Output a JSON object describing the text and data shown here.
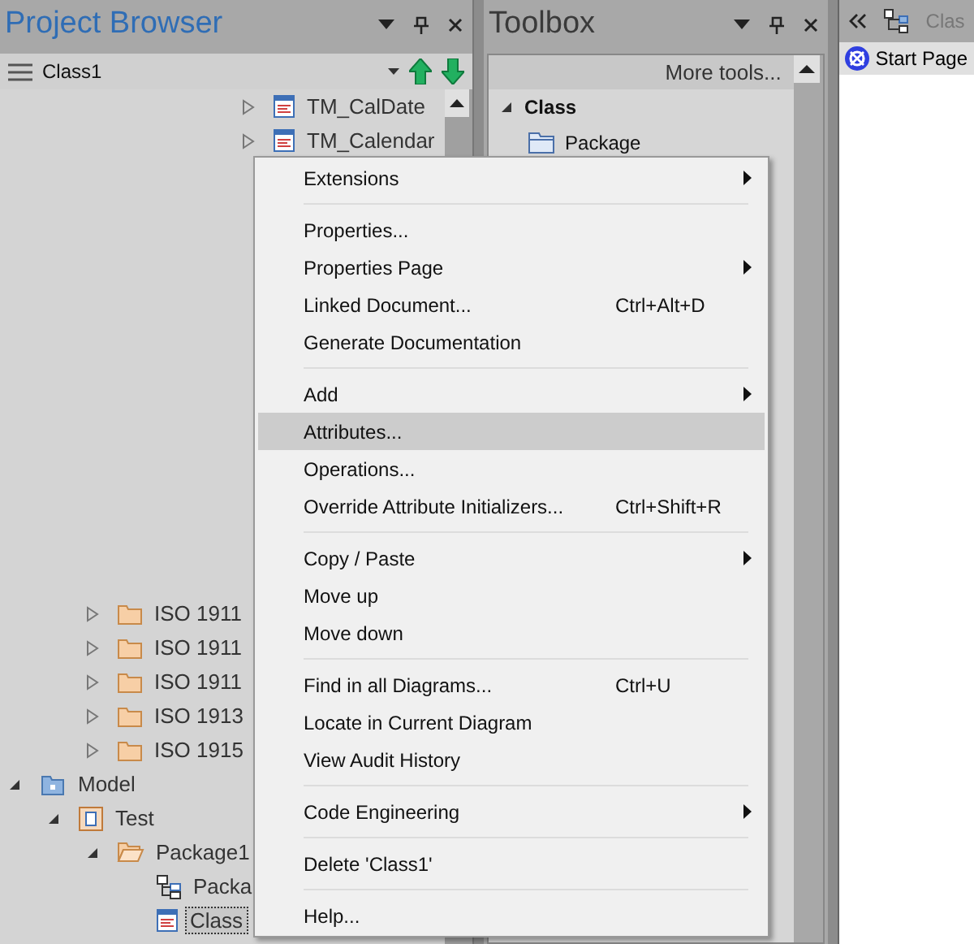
{
  "project_browser": {
    "title": "Project Browser",
    "toolbar": {
      "current": "Class1"
    },
    "upper_items": [
      {
        "label": "TM_CalDate",
        "kind": "class",
        "expanded": false,
        "selected": false
      },
      {
        "label": "TM_Calendar",
        "kind": "class",
        "expanded": false,
        "selected": false
      }
    ],
    "middle_items": [
      {
        "label": "ISO 1911",
        "kind": "folder",
        "expanded": false,
        "selected": false
      },
      {
        "label": "ISO 1911",
        "kind": "folder",
        "expanded": false,
        "selected": false
      },
      {
        "label": "ISO 1911",
        "kind": "folder",
        "expanded": false,
        "selected": false
      },
      {
        "label": "ISO 1913",
        "kind": "folder",
        "expanded": false,
        "selected": false
      },
      {
        "label": "ISO 1915",
        "kind": "folder",
        "expanded": false,
        "selected": false
      }
    ],
    "roots": [
      {
        "label": "Model",
        "kind": "model",
        "expanded": true,
        "selected": false,
        "children": [
          {
            "label": "Test",
            "kind": "view",
            "expanded": true,
            "selected": false,
            "children": [
              {
                "label": "Package1",
                "kind": "package",
                "expanded": true,
                "selected": false,
                "children": [
                  {
                    "label": "Packa",
                    "kind": "diagram",
                    "selected": false
                  },
                  {
                    "label": "Class",
                    "kind": "class",
                    "selected": true
                  }
                ]
              }
            ]
          }
        ]
      }
    ]
  },
  "toolbox": {
    "title": "Toolbox",
    "more_tools": "More tools...",
    "group": {
      "label": "Class",
      "expanded": true
    },
    "items": [
      {
        "label": "Package"
      }
    ]
  },
  "diagram_panel": {
    "tab_title": "Clas",
    "start_page": "Start Page"
  },
  "context_menu": {
    "items": [
      {
        "kind": "item",
        "label": "Extensions",
        "submenu": true,
        "selected": false
      },
      {
        "kind": "separator"
      },
      {
        "kind": "item",
        "label": "Properties...",
        "submenu": false,
        "selected": false
      },
      {
        "kind": "item",
        "label": "Properties Page",
        "submenu": true,
        "selected": false
      },
      {
        "kind": "item",
        "label": "Linked Document...",
        "shortcut": "Ctrl+Alt+D",
        "submenu": false,
        "selected": false
      },
      {
        "kind": "item",
        "label": "Generate Documentation",
        "submenu": false,
        "selected": false
      },
      {
        "kind": "separator"
      },
      {
        "kind": "item",
        "label": "Add",
        "submenu": true,
        "selected": false
      },
      {
        "kind": "item",
        "label": "Attributes...",
        "submenu": false,
        "selected": true
      },
      {
        "kind": "item",
        "label": "Operations...",
        "submenu": false,
        "selected": false
      },
      {
        "kind": "item",
        "label": "Override Attribute Initializers...",
        "shortcut": "Ctrl+Shift+R",
        "submenu": false,
        "selected": false
      },
      {
        "kind": "separator"
      },
      {
        "kind": "item",
        "label": "Copy / Paste",
        "submenu": true,
        "selected": false
      },
      {
        "kind": "item",
        "label": "Move up",
        "submenu": false,
        "selected": false
      },
      {
        "kind": "item",
        "label": "Move down",
        "submenu": false,
        "selected": false
      },
      {
        "kind": "separator"
      },
      {
        "kind": "item",
        "label": "Find in all Diagrams...",
        "shortcut": "Ctrl+U",
        "submenu": false,
        "selected": false
      },
      {
        "kind": "item",
        "label": "Locate in Current Diagram",
        "submenu": false,
        "selected": false
      },
      {
        "kind": "item",
        "label": "View Audit History",
        "submenu": false,
        "selected": false
      },
      {
        "kind": "separator"
      },
      {
        "kind": "item",
        "label": "Code Engineering",
        "submenu": true,
        "selected": false
      },
      {
        "kind": "separator"
      },
      {
        "kind": "item",
        "label": "Delete 'Class1'",
        "submenu": false,
        "selected": false
      },
      {
        "kind": "separator"
      },
      {
        "kind": "item",
        "label": "Help...",
        "submenu": false,
        "selected": false
      }
    ]
  }
}
